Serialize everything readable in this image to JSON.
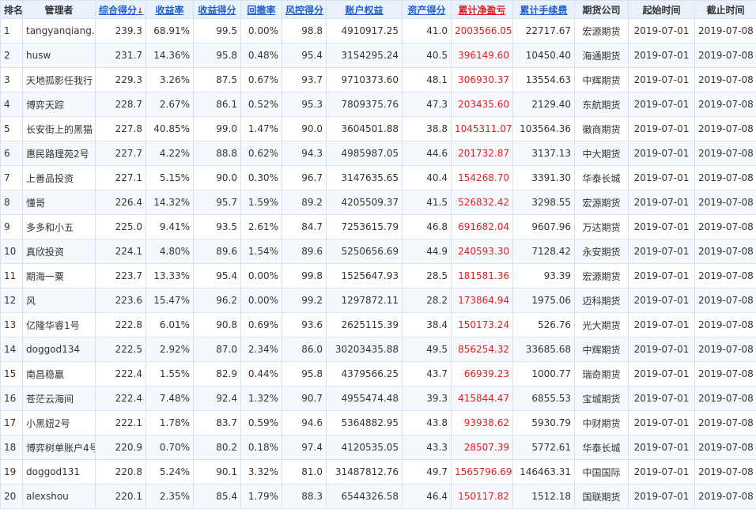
{
  "headers": {
    "rank": "排名",
    "manager": "管理者",
    "composite": "综合得分",
    "sort_arrow": "↓",
    "return_rate": "收益率",
    "return_score": "收益得分",
    "drawdown": "回撤率",
    "risk_score": "风控得分",
    "equity": "账户权益",
    "asset_score": "资产得分",
    "cum_pnl": "累计净盈亏",
    "cum_fee": "累计手续费",
    "broker": "期货公司",
    "start": "起始时间",
    "end": "截止时间"
  },
  "rows": [
    {
      "rank": "1",
      "manager": "tangyanqiang.",
      "composite": "239.3",
      "return_rate": "68.91%",
      "return_score": "99.5",
      "drawdown": "0.00%",
      "risk_score": "98.8",
      "equity": "4910917.25",
      "asset_score": "41.0",
      "cum_pnl": "2003566.05",
      "cum_fee": "22717.67",
      "broker": "宏源期货",
      "start": "2019-07-01",
      "end": "2019-07-08"
    },
    {
      "rank": "2",
      "manager": "husw",
      "composite": "231.7",
      "return_rate": "14.36%",
      "return_score": "95.8",
      "drawdown": "0.48%",
      "risk_score": "95.4",
      "equity": "3154295.24",
      "asset_score": "40.5",
      "cum_pnl": "396149.60",
      "cum_fee": "10450.40",
      "broker": "海通期货",
      "start": "2019-07-01",
      "end": "2019-07-08"
    },
    {
      "rank": "3",
      "manager": "天地孤影任我行",
      "composite": "229.3",
      "return_rate": "3.26%",
      "return_score": "87.5",
      "drawdown": "0.67%",
      "risk_score": "93.7",
      "equity": "9710373.60",
      "asset_score": "48.1",
      "cum_pnl": "306930.37",
      "cum_fee": "13554.63",
      "broker": "中辉期货",
      "start": "2019-07-01",
      "end": "2019-07-08"
    },
    {
      "rank": "4",
      "manager": "博弈天踪",
      "composite": "228.7",
      "return_rate": "2.67%",
      "return_score": "86.1",
      "drawdown": "0.52%",
      "risk_score": "95.3",
      "equity": "7809375.76",
      "asset_score": "47.3",
      "cum_pnl": "203435.60",
      "cum_fee": "2129.40",
      "broker": "东航期货",
      "start": "2019-07-01",
      "end": "2019-07-08"
    },
    {
      "rank": "5",
      "manager": "长安街上的黑猫",
      "composite": "227.8",
      "return_rate": "40.85%",
      "return_score": "99.0",
      "drawdown": "1.47%",
      "risk_score": "90.0",
      "equity": "3604501.88",
      "asset_score": "38.8",
      "cum_pnl": "1045311.07",
      "cum_fee": "103564.36",
      "broker": "徽商期货",
      "start": "2019-07-01",
      "end": "2019-07-08"
    },
    {
      "rank": "6",
      "manager": "惠民路理苑2号",
      "composite": "227.7",
      "return_rate": "4.22%",
      "return_score": "88.8",
      "drawdown": "0.62%",
      "risk_score": "94.3",
      "equity": "4985987.05",
      "asset_score": "44.6",
      "cum_pnl": "201732.87",
      "cum_fee": "3137.13",
      "broker": "中大期货",
      "start": "2019-07-01",
      "end": "2019-07-08"
    },
    {
      "rank": "7",
      "manager": "上善品投资",
      "composite": "227.1",
      "return_rate": "5.15%",
      "return_score": "90.0",
      "drawdown": "0.30%",
      "risk_score": "96.7",
      "equity": "3147635.65",
      "asset_score": "40.4",
      "cum_pnl": "154268.70",
      "cum_fee": "3391.30",
      "broker": "华泰长城",
      "start": "2019-07-01",
      "end": "2019-07-08"
    },
    {
      "rank": "8",
      "manager": "懂哥",
      "composite": "226.4",
      "return_rate": "14.32%",
      "return_score": "95.7",
      "drawdown": "1.59%",
      "risk_score": "89.2",
      "equity": "4205509.37",
      "asset_score": "41.5",
      "cum_pnl": "526832.42",
      "cum_fee": "3298.55",
      "broker": "宏源期货",
      "start": "2019-07-01",
      "end": "2019-07-08"
    },
    {
      "rank": "9",
      "manager": "多多和小五",
      "composite": "225.0",
      "return_rate": "9.41%",
      "return_score": "93.5",
      "drawdown": "2.61%",
      "risk_score": "84.7",
      "equity": "7253615.79",
      "asset_score": "46.8",
      "cum_pnl": "691682.04",
      "cum_fee": "9607.96",
      "broker": "万达期货",
      "start": "2019-07-01",
      "end": "2019-07-08"
    },
    {
      "rank": "10",
      "manager": "真欣投资",
      "composite": "224.1",
      "return_rate": "4.80%",
      "return_score": "89.6",
      "drawdown": "1.54%",
      "risk_score": "89.6",
      "equity": "5250656.69",
      "asset_score": "44.9",
      "cum_pnl": "240593.30",
      "cum_fee": "7128.42",
      "broker": "永安期货",
      "start": "2019-07-01",
      "end": "2019-07-08"
    },
    {
      "rank": "11",
      "manager": "期海一粟",
      "composite": "223.7",
      "return_rate": "13.33%",
      "return_score": "95.4",
      "drawdown": "0.00%",
      "risk_score": "99.8",
      "equity": "1525647.93",
      "asset_score": "28.5",
      "cum_pnl": "181581.36",
      "cum_fee": "93.39",
      "broker": "宏源期货",
      "start": "2019-07-01",
      "end": "2019-07-08"
    },
    {
      "rank": "12",
      "manager": "风",
      "composite": "223.6",
      "return_rate": "15.47%",
      "return_score": "96.2",
      "drawdown": "0.00%",
      "risk_score": "99.2",
      "equity": "1297872.11",
      "asset_score": "28.2",
      "cum_pnl": "173864.94",
      "cum_fee": "1975.06",
      "broker": "迈科期货",
      "start": "2019-07-01",
      "end": "2019-07-08"
    },
    {
      "rank": "13",
      "manager": "亿隆华睿1号",
      "composite": "222.8",
      "return_rate": "6.01%",
      "return_score": "90.8",
      "drawdown": "0.69%",
      "risk_score": "93.6",
      "equity": "2625115.39",
      "asset_score": "38.4",
      "cum_pnl": "150173.24",
      "cum_fee": "526.76",
      "broker": "光大期货",
      "start": "2019-07-01",
      "end": "2019-07-08"
    },
    {
      "rank": "14",
      "manager": "doggod134",
      "composite": "222.5",
      "return_rate": "2.92%",
      "return_score": "87.0",
      "drawdown": "2.34%",
      "risk_score": "86.0",
      "equity": "30203435.88",
      "asset_score": "49.5",
      "cum_pnl": "856254.32",
      "cum_fee": "33685.68",
      "broker": "中辉期货",
      "start": "2019-07-01",
      "end": "2019-07-08"
    },
    {
      "rank": "15",
      "manager": "南昌稳赢",
      "composite": "222.4",
      "return_rate": "1.55%",
      "return_score": "82.9",
      "drawdown": "0.44%",
      "risk_score": "95.8",
      "equity": "4379566.25",
      "asset_score": "43.7",
      "cum_pnl": "66939.23",
      "cum_fee": "1000.77",
      "broker": "瑞奇期货",
      "start": "2019-07-01",
      "end": "2019-07-08"
    },
    {
      "rank": "16",
      "manager": "苍茫云海间",
      "composite": "222.4",
      "return_rate": "7.48%",
      "return_score": "92.4",
      "drawdown": "1.32%",
      "risk_score": "90.7",
      "equity": "4955474.48",
      "asset_score": "39.3",
      "cum_pnl": "415844.47",
      "cum_fee": "6855.53",
      "broker": "宝城期货",
      "start": "2019-07-01",
      "end": "2019-07-08"
    },
    {
      "rank": "17",
      "manager": "小黑妞2号",
      "composite": "222.1",
      "return_rate": "1.78%",
      "return_score": "83.7",
      "drawdown": "0.59%",
      "risk_score": "94.6",
      "equity": "5364882.95",
      "asset_score": "43.8",
      "cum_pnl": "93938.62",
      "cum_fee": "5930.79",
      "broker": "中财期货",
      "start": "2019-07-01",
      "end": "2019-07-08"
    },
    {
      "rank": "18",
      "manager": "博弈树单账户4号",
      "composite": "220.9",
      "return_rate": "0.70%",
      "return_score": "80.2",
      "drawdown": "0.18%",
      "risk_score": "97.4",
      "equity": "4120535.05",
      "asset_score": "43.3",
      "cum_pnl": "28507.39",
      "cum_fee": "5772.61",
      "broker": "华泰长城",
      "start": "2019-07-01",
      "end": "2019-07-08"
    },
    {
      "rank": "19",
      "manager": "doggod131",
      "composite": "220.8",
      "return_rate": "5.24%",
      "return_score": "90.1",
      "drawdown": "3.32%",
      "risk_score": "81.0",
      "equity": "31487812.76",
      "asset_score": "49.7",
      "cum_pnl": "1565796.69",
      "cum_fee": "146463.31",
      "broker": "中国国际",
      "start": "2019-07-01",
      "end": "2019-07-08"
    },
    {
      "rank": "20",
      "manager": "alexshou",
      "composite": "220.1",
      "return_rate": "2.35%",
      "return_score": "85.4",
      "drawdown": "1.79%",
      "risk_score": "88.3",
      "equity": "6544326.58",
      "asset_score": "46.4",
      "cum_pnl": "150117.82",
      "cum_fee": "1512.18",
      "broker": "国联期货",
      "start": "2019-07-01",
      "end": "2019-07-08"
    }
  ]
}
